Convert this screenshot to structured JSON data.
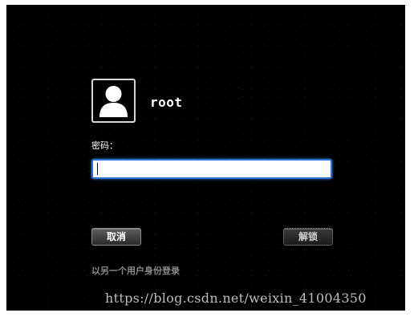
{
  "user": {
    "name": "root",
    "avatar_icon": "user-silhouette-icon"
  },
  "password": {
    "label": "密码：",
    "value": "",
    "placeholder": ""
  },
  "actions": {
    "cancel_label": "取消",
    "unlock_label": "解锁",
    "other_user_label": "以另一个用户身份登录"
  },
  "watermark": {
    "text": "https://blog.csdn.net/weixin_41004350"
  },
  "colors": {
    "background": "#000000",
    "input_focus": "#2c6fd6",
    "text": "#ffffff",
    "muted_text": "#8a8a8a"
  }
}
